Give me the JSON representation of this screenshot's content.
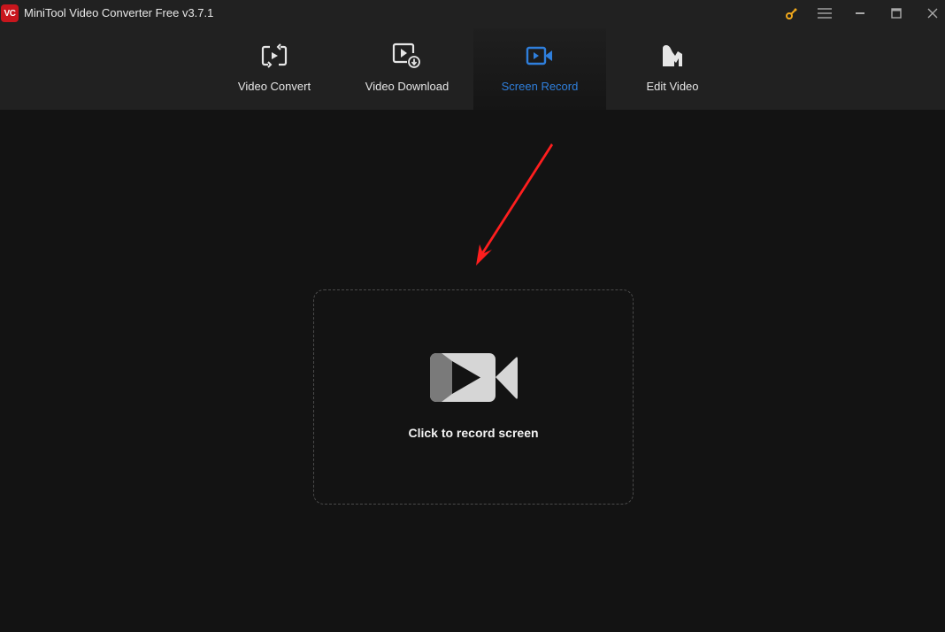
{
  "app": {
    "title": "MiniTool Video Converter Free v3.7.1",
    "logo_text": "VC",
    "logo_color": "#c8161d"
  },
  "window_controls": {
    "icons": [
      "key-icon",
      "menu-icon",
      "minimize-icon",
      "maximize-icon",
      "close-icon"
    ],
    "key_color": "#f0a81c"
  },
  "nav": {
    "active_color": "#2f7fdc",
    "tabs": [
      {
        "label": "Video Convert",
        "icon": "video-convert-icon",
        "active": false
      },
      {
        "label": "Video Download",
        "icon": "video-download-icon",
        "active": false
      },
      {
        "label": "Screen Record",
        "icon": "screen-record-icon",
        "active": true
      },
      {
        "label": "Edit Video",
        "icon": "edit-video-icon",
        "active": false
      }
    ]
  },
  "main": {
    "record_label": "Click to record screen",
    "annotation_arrow_color": "#ff1e1e"
  }
}
